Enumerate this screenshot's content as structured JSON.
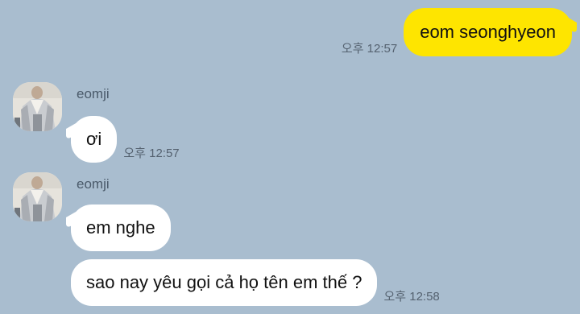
{
  "messages": {
    "sent": {
      "text": "eom seonghyeon",
      "time": "오후 12:57"
    },
    "group1": {
      "sender": "eomji",
      "bubbles": [
        {
          "text": "ơi",
          "time": "오후 12:57"
        }
      ]
    },
    "group2": {
      "sender": "eomji",
      "bubbles": [
        {
          "text": "em nghe",
          "time": ""
        },
        {
          "text": "sao nay yêu gọi cả họ tên em thế ?",
          "time": "오후 12:58"
        }
      ]
    }
  },
  "colors": {
    "background": "#a9bdcf",
    "sent_bubble": "#fee500",
    "received_bubble": "#ffffff"
  },
  "icons": {
    "avatar": "profile-photo"
  }
}
